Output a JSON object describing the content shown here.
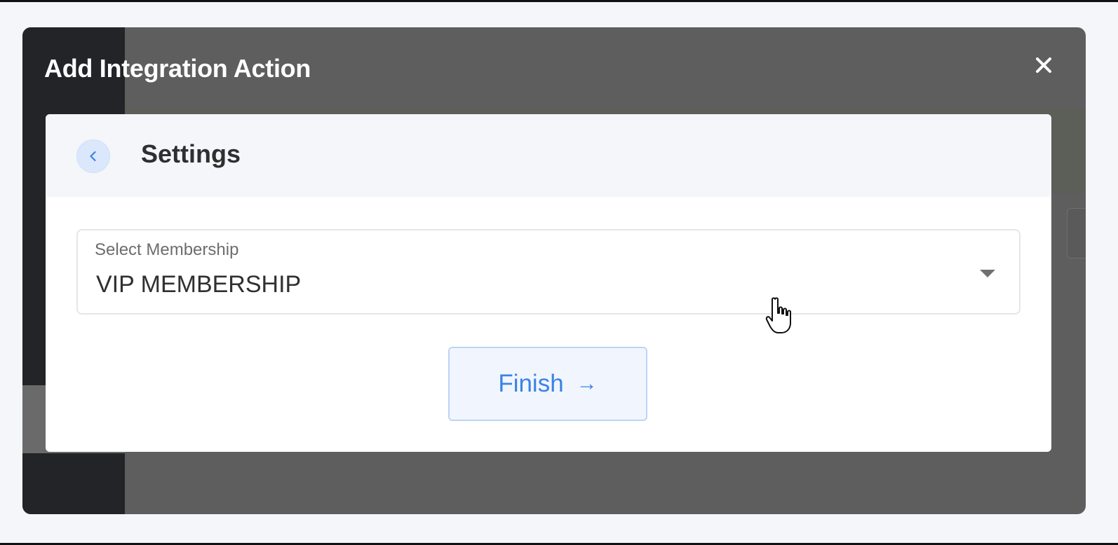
{
  "modal": {
    "title": "Add Integration Action",
    "close_icon": "close-icon"
  },
  "card": {
    "title": "Settings",
    "back_icon": "chevron-left-icon"
  },
  "membership_select": {
    "label": "Select Membership",
    "value": "VIP MEMBERSHIP",
    "caret_icon": "caret-down-icon"
  },
  "finish_button": {
    "label": "Finish",
    "arrow": "→"
  },
  "colors": {
    "accent": "#3b82e6",
    "overlay": "#5e5e5e",
    "page_bg": "#f4f6fa"
  }
}
